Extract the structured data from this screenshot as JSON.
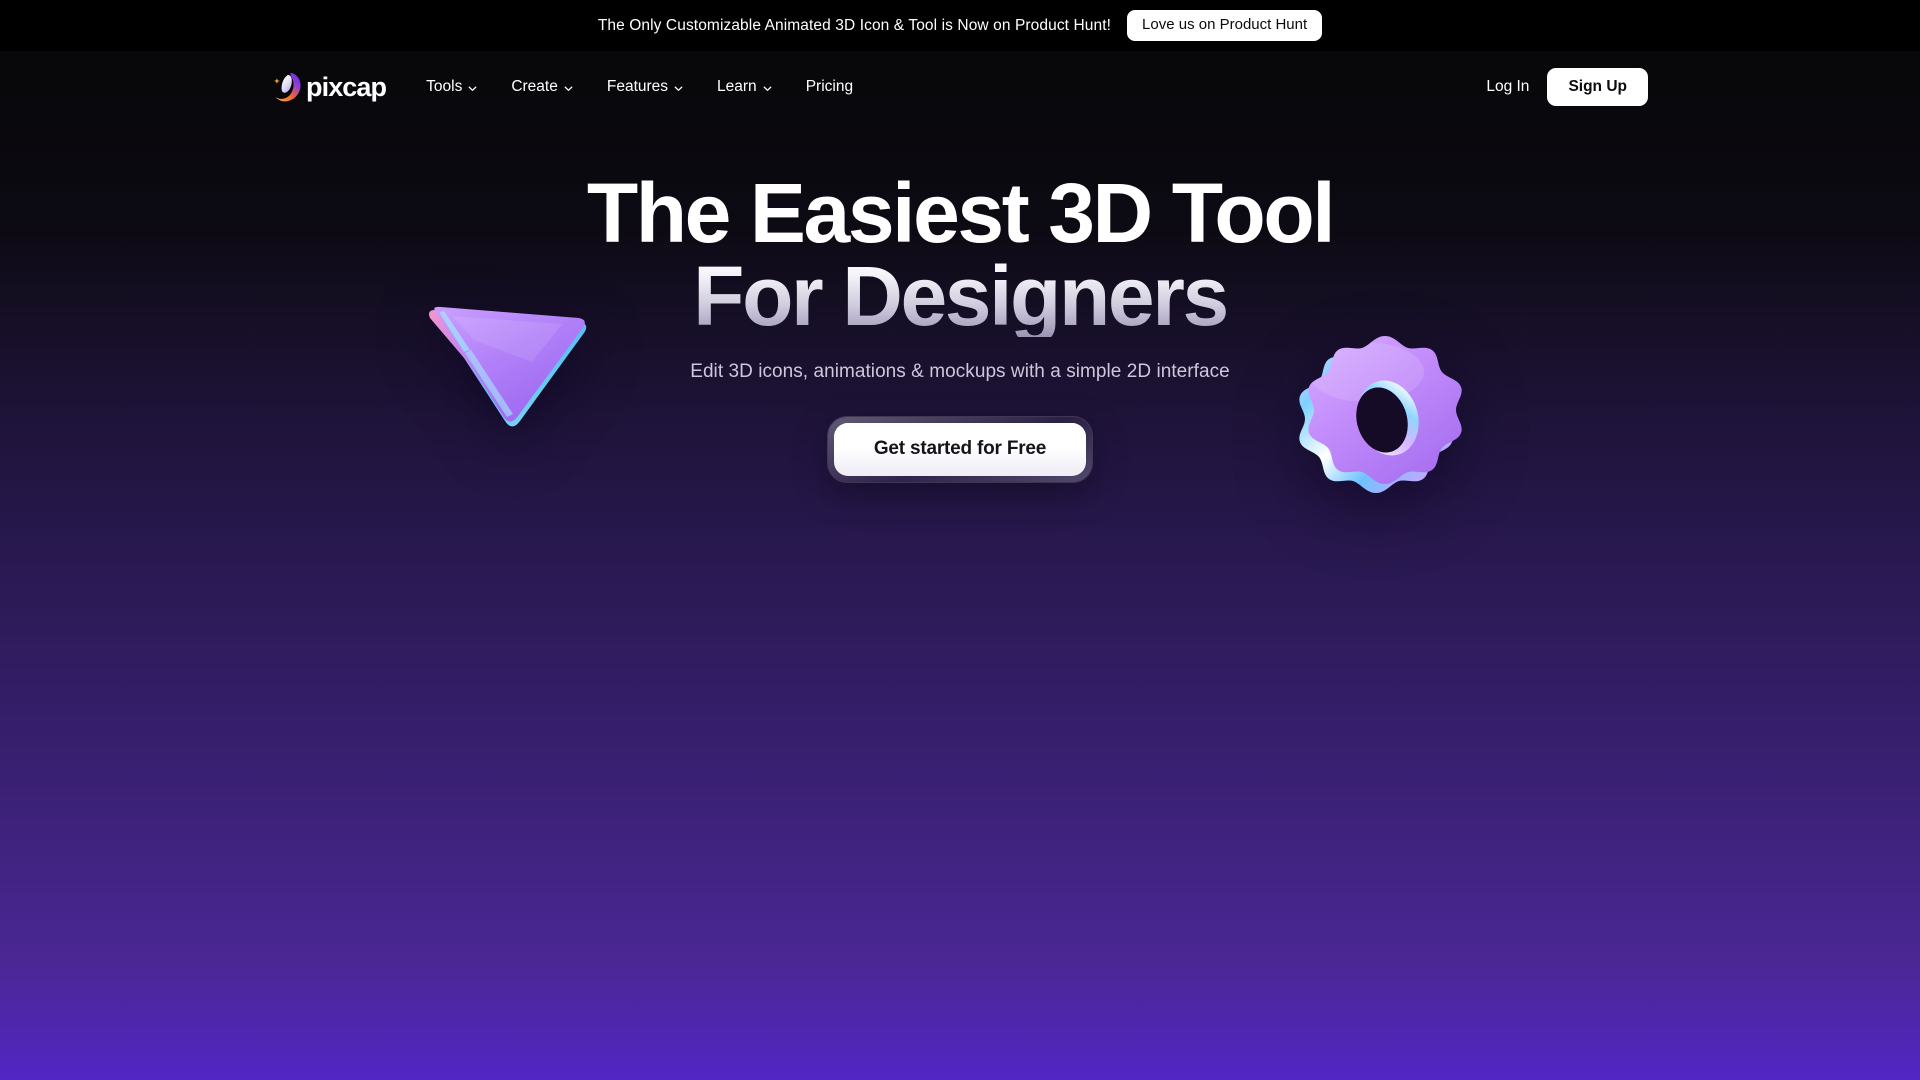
{
  "banner": {
    "message": "The Only Customizable Animated 3D Icon & Tool is Now on Product Hunt!",
    "cta_label": "Love us on Product Hunt",
    "background": "#000000"
  },
  "nav": {
    "brand": {
      "name": "pixcap",
      "logo_icon": "pixcap-crescent-logo"
    },
    "links": [
      {
        "label": "Tools",
        "has_dropdown": true,
        "icon": "chevron-down-icon"
      },
      {
        "label": "Create",
        "has_dropdown": true,
        "icon": "chevron-down-icon"
      },
      {
        "label": "Features",
        "has_dropdown": true,
        "icon": "chevron-down-icon"
      },
      {
        "label": "Learn",
        "has_dropdown": true,
        "icon": "chevron-down-icon"
      },
      {
        "label": "Pricing",
        "has_dropdown": false,
        "icon": ""
      }
    ],
    "login_label": "Log In",
    "signup_label": "Sign Up"
  },
  "hero": {
    "headline_line1": "The Easiest 3D Tool",
    "headline_line2": "For Designers",
    "subtitle": "Edit 3D icons, animations & mockups with a simple 2D interface",
    "cta_label": "Get started for Free",
    "decorations": [
      {
        "icon": "3d-cursor-icon",
        "position": "left"
      },
      {
        "icon": "3d-gear-icon",
        "position": "right"
      }
    ]
  },
  "theme": {
    "background_top": "#070709",
    "background_bottom": "#5226c4",
    "accent_purple": "#a97cf8",
    "text_primary": "#ffffff",
    "text_muted": "#cdc6dc",
    "button_surface": "#ffffff"
  }
}
